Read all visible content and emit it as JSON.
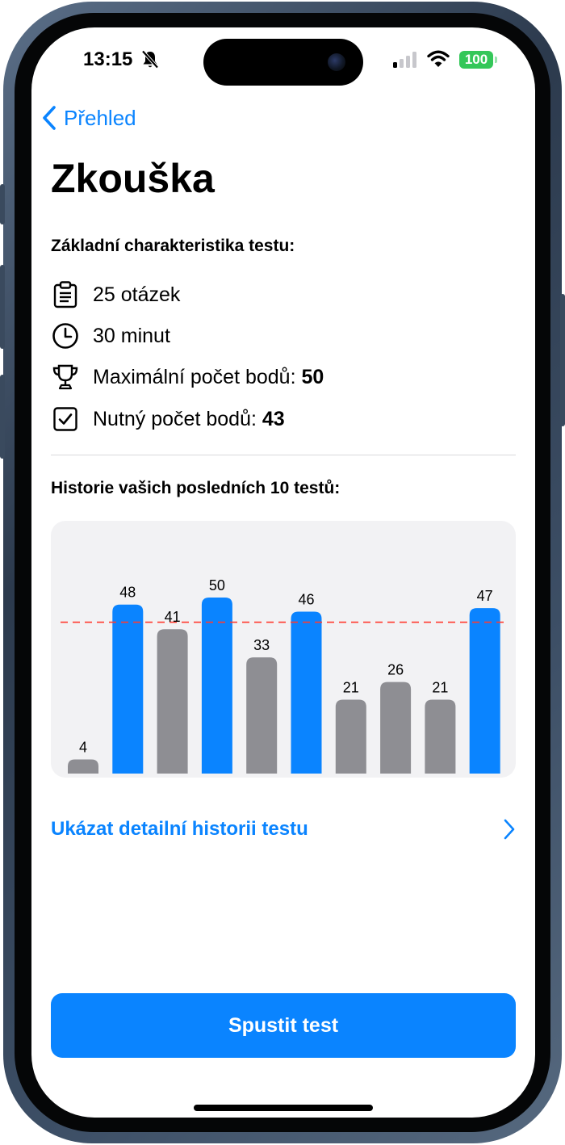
{
  "status_bar": {
    "time": "13:15",
    "battery": "100",
    "icons": [
      "bell-slash-icon",
      "cellular-signal-icon",
      "wifi-icon",
      "battery-icon"
    ]
  },
  "nav": {
    "back_label": "Přehled"
  },
  "title": "Zkouška",
  "characteristics": {
    "heading": "Základní charakteristika testu:",
    "questions": "25 otázek",
    "time_limit": "30 minut",
    "max_points_label": "Maximální počet bodů:",
    "max_points_value": "50",
    "required_points_label": "Nutný počet bodů:",
    "required_points_value": "43"
  },
  "history": {
    "heading": "Historie vašich posledních 10 testů:",
    "detail_link": "Ukázat detailní historii testu"
  },
  "start_button": "Spustit test",
  "colors": {
    "accent": "#0a84ff",
    "passed_bar": "#0a84ff",
    "failed_bar": "#8e8e93",
    "threshold_line": "#ff3b30",
    "battery": "#34c759"
  },
  "chart_data": {
    "type": "bar",
    "values": [
      4,
      48,
      41,
      50,
      33,
      46,
      21,
      26,
      21,
      47
    ],
    "threshold": 43,
    "max": 50,
    "ylim": [
      0,
      50
    ],
    "passed": [
      false,
      true,
      false,
      true,
      false,
      true,
      false,
      false,
      false,
      true
    ],
    "data_labels": [
      "4",
      "48",
      "41",
      "50",
      "33",
      "46",
      "21",
      "26",
      "21",
      "47"
    ],
    "grid": false
  }
}
